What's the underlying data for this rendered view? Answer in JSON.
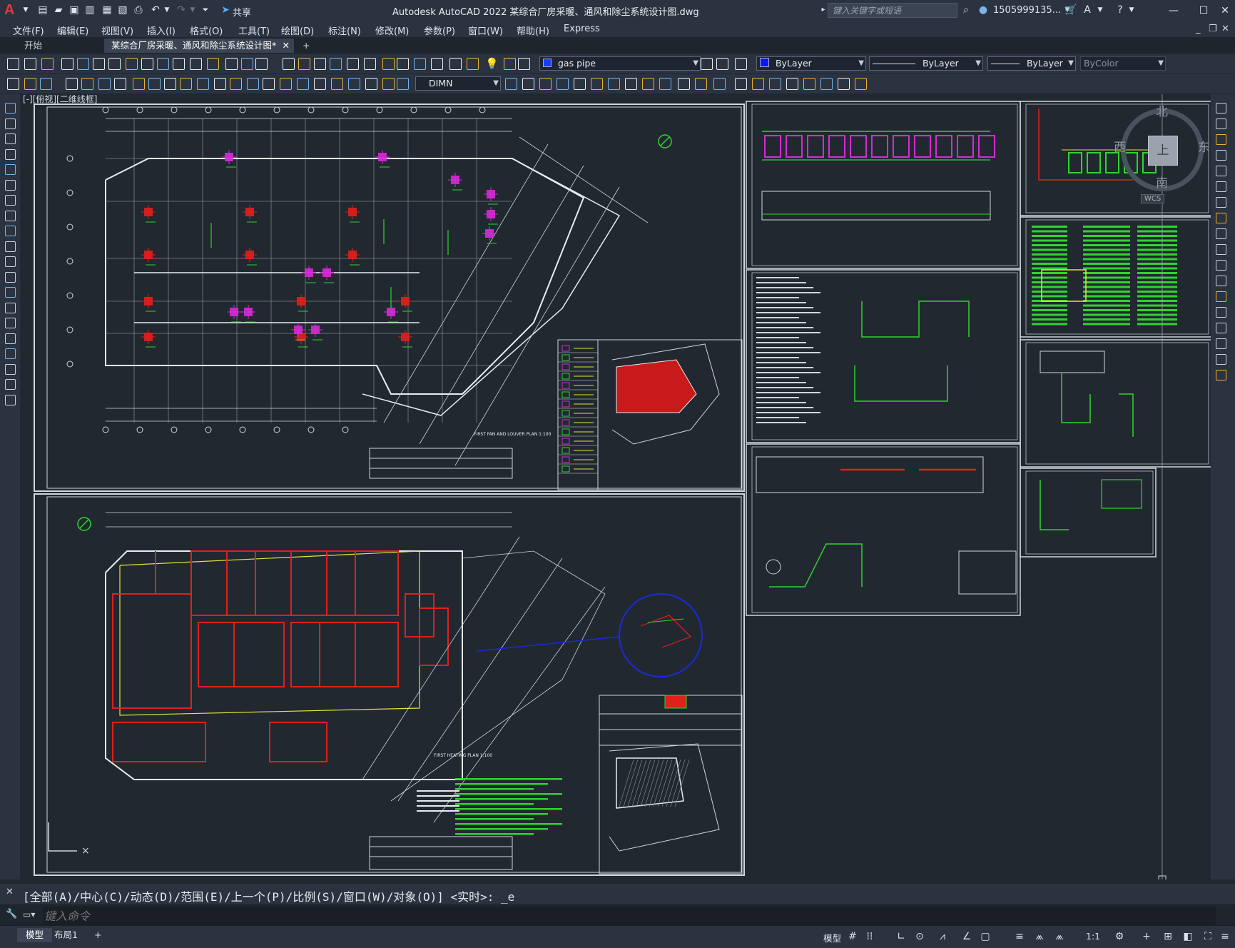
{
  "app": {
    "logo": "A",
    "title": "Autodesk AutoCAD 2022    某综合厂房采暖、通风和除尘系统设计图.dwg",
    "share_label": "共享",
    "search_placeholder": "键入关键字或短语",
    "user": "1505999135...",
    "window_controls": [
      "minimize-icon",
      "maximize-icon",
      "close-icon"
    ]
  },
  "menu": {
    "items": [
      "文件(F)",
      "编辑(E)",
      "视图(V)",
      "插入(I)",
      "格式(O)",
      "工具(T)",
      "绘图(D)",
      "标注(N)",
      "修改(M)",
      "参数(P)",
      "窗口(W)",
      "帮助(H)",
      "Express"
    ]
  },
  "tabs": {
    "start": "开始",
    "active_doc": "某综合厂房采暖、通风和除尘系统设计图*",
    "add": "+"
  },
  "properties": {
    "layer": "gas pipe",
    "color": "ByLayer",
    "linetype": "ByLayer",
    "lineweight": "ByLayer",
    "plotstyle": "ByColor",
    "dimstyle": "DIMN"
  },
  "viewport": {
    "label": "[-][俯视][二维线框]",
    "viewcube": {
      "north": "北",
      "south": "南",
      "east": "东",
      "west": "西",
      "top": "上",
      "wcs": "WCS"
    }
  },
  "drawing": {
    "sheet1_title": "FIRST FAN AND LOUVER PLAN  1:100",
    "sheet2_title": "FIRST HEATING PLAN 1:100"
  },
  "command": {
    "history": "[全部(A)/中心(C)/动态(D)/范围(E)/上一个(P)/比例(S)/窗口(W)/对象(O)] <实时>: _e",
    "placeholder": "键入命令"
  },
  "status": {
    "model_tab": "模型",
    "layout_tab": "布局1",
    "add_tab": "+",
    "model_label": "模型",
    "scale": "1:1"
  }
}
